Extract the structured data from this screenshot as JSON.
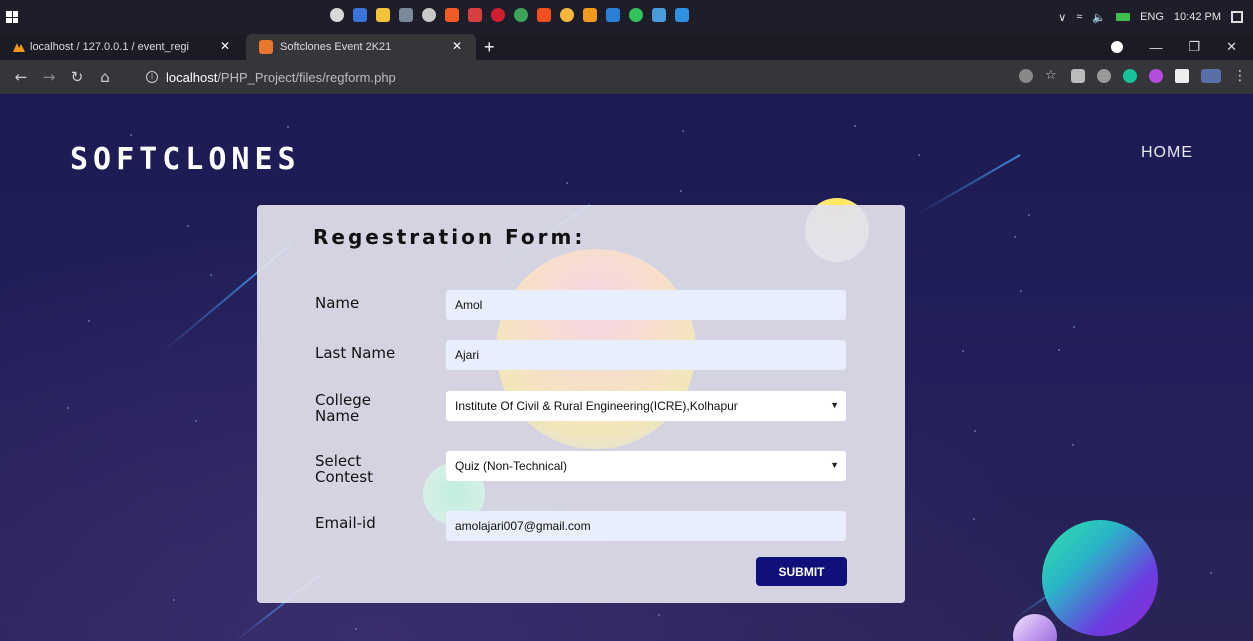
{
  "browser": {
    "tabs": [
      {
        "label": "localhost / 127.0.0.1 / event_regi",
        "active": false
      },
      {
        "label": "Softclones Event 2K21",
        "active": true
      }
    ],
    "url_host": "localhost",
    "url_path": "/PHP_Project/files/regform.php"
  },
  "system_tray": {
    "language": "ENG",
    "time": "10:42 PM"
  },
  "site": {
    "logo": "SOFTCLONES",
    "nav_home": "HOME"
  },
  "form": {
    "title": "Regestration Form:",
    "fields": {
      "name": {
        "label": "Name",
        "value": "Amol"
      },
      "last_name": {
        "label": "Last Name",
        "value": "Ajari"
      },
      "college": {
        "label_line1": "College",
        "label_line2": "Name",
        "value": "Institute Of Civil & Rural Engineering(ICRE),Kolhapur"
      },
      "contest": {
        "label_line1": "Select",
        "label_line2": "Contest",
        "value": "Quiz (Non-Technical)"
      },
      "email": {
        "label": "Email-id",
        "value": "amolajari007@gmail.com"
      }
    },
    "submit_label": "SUBMIT"
  },
  "colors": {
    "page_bg": "#1c1b52",
    "card_bg": "#e2e1ec",
    "submit_bg": "#10107a",
    "input_bg": "#e8eefb"
  }
}
